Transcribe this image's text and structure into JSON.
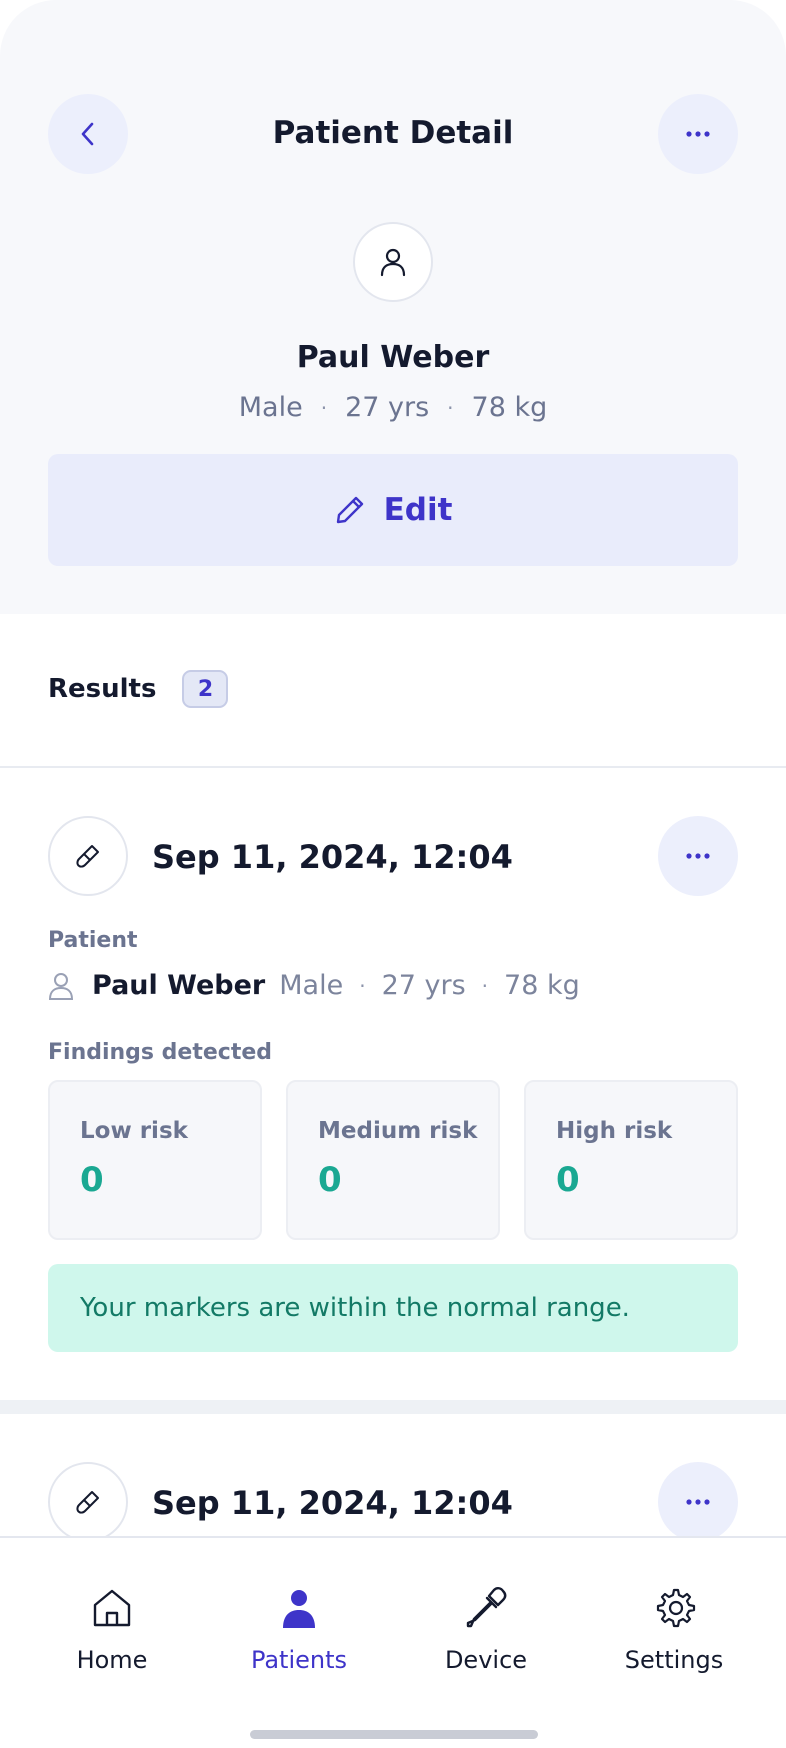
{
  "header": {
    "title": "Patient Detail"
  },
  "patient": {
    "name": "Paul Weber",
    "sex": "Male",
    "age": "27 yrs",
    "weight": "78 kg",
    "separator": "·"
  },
  "edit_button": {
    "label": "Edit"
  },
  "results": {
    "label": "Results",
    "count": "2",
    "items": [
      {
        "date": "Sep 11, 2024, 12:04",
        "patient_label": "Patient",
        "patient_name": "Paul Weber",
        "patient_sex": "Male",
        "patient_age": "27 yrs",
        "patient_weight": "78 kg",
        "findings_label": "Findings detected",
        "risks": [
          {
            "label": "Low risk",
            "value": "0"
          },
          {
            "label": "Medium risk",
            "value": "0"
          },
          {
            "label": "High risk",
            "value": "0"
          }
        ],
        "status_message": "Your markers are within the normal range."
      },
      {
        "date": "Sep 11, 2024, 12:04"
      }
    ]
  },
  "bottom_nav": {
    "items": [
      {
        "label": "Home",
        "icon": "home-icon",
        "active": false
      },
      {
        "label": "Patients",
        "icon": "person-icon",
        "active": true
      },
      {
        "label": "Device",
        "icon": "dropper-icon",
        "active": false
      },
      {
        "label": "Settings",
        "icon": "gear-icon",
        "active": false
      }
    ]
  },
  "colors": {
    "accent": "#3e34c9",
    "success_bg": "#cff7ec",
    "success_text": "#137a66",
    "risk_value": "#1aa892"
  }
}
